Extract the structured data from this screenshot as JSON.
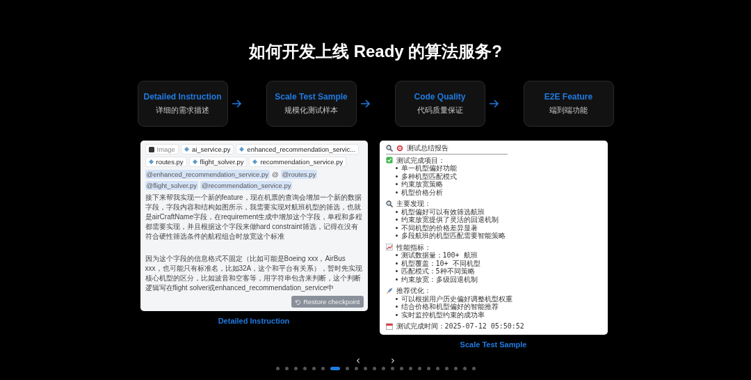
{
  "title": "如何开发上线 Ready 的算法服务?",
  "steps": [
    {
      "title": "Detailed Instruction",
      "subtitle": "详细的需求描述"
    },
    {
      "title": "Scale Test Sample",
      "subtitle": "规模化测试样本"
    },
    {
      "title": "Code Quality",
      "subtitle": "代码质量保证"
    },
    {
      "title": "E2E Feature",
      "subtitle": "端到端功能"
    }
  ],
  "instruction_panel": {
    "attachments": [
      {
        "kind": "image",
        "label": "Image"
      },
      {
        "kind": "file",
        "label": "ai_service.py"
      },
      {
        "kind": "file",
        "label": "enhanced_recommendation_servic..."
      },
      {
        "kind": "file",
        "label": "routes.py"
      },
      {
        "kind": "file",
        "label": "flight_solver.py"
      },
      {
        "kind": "file",
        "label": "recommendation_service.py"
      }
    ],
    "mentions": [
      {
        "kind": "tag",
        "text": "@enhanced_recommendation_service.py"
      },
      {
        "kind": "plain",
        "text": "@"
      },
      {
        "kind": "tag",
        "text": "@routes.py"
      },
      {
        "kind": "tag",
        "text": "@flight_solver.py"
      },
      {
        "kind": "tag",
        "text": "@recommendation_service.py"
      }
    ],
    "paragraphs": [
      "接下来帮我实现一个新的feature，现在机票的查询会增加一个新的数据字段，字段内容和结构如图所示，我需要实现对航班机型的筛选，也就是airCraftName字段，在requirement生成中增加这个字段，单程和多程都需要实现，并且根据这个字段来做hard constraint筛选，记得在没有符合硬性筛选条件的航程组合时放宽这个标准",
      "因为这个字段的信息格式不固定（比如可能是Boeing xxx，AirBus xxx，也可能只有标准名，比如32A，这个和平台有关系），暂时先实现核心机型的区分，比如波音和空客等，用字符串包含来判断，这个判断逻辑写在flight solver或enhanced_recommendation_service中"
    ],
    "button": "Restore checkpoint",
    "caption": "Detailed Instruction"
  },
  "report_panel": {
    "title": "测试总结报告",
    "sections": [
      {
        "kind": "check",
        "heading": "测试完成项目：",
        "items": [
          "单一机型偏好功能",
          "多种机型匹配模式",
          "约束放宽策略",
          "机型价格分析"
        ]
      },
      {
        "kind": "search",
        "heading": "主要发现：",
        "items": [
          "机型偏好可以有效筛选航班",
          "约束放宽提供了灵活的回退机制",
          "不同机型的价格差异显著",
          "多段航班的机型匹配需要智能策略"
        ]
      },
      {
        "kind": "chart",
        "heading": "性能指标：",
        "items": [
          "测试数据量：100+ 航班",
          "机型覆盖：10+ 不同机型",
          "匹配模式：5种不同策略",
          "约束放宽：多级回退机制"
        ]
      },
      {
        "kind": "rocket",
        "heading": "推荐优化：",
        "items": [
          "可以根据用户历史偏好调整机型权重",
          "结合价格和机型偏好的智能推荐",
          "实时监控机型约束的成功率"
        ]
      }
    ],
    "footer": "测试完成时间：2025-07-12 05:50:52",
    "caption": "Scale Test Sample"
  },
  "carousel": {
    "prev": "‹",
    "next": "›",
    "dots": [
      {
        "selected": false
      },
      {
        "selected": false
      },
      {
        "selected": false
      },
      {
        "selected": false
      },
      {
        "selected": false
      },
      {
        "selected": false
      },
      {
        "selected": true
      },
      {
        "selected": false
      },
      {
        "selected": false
      },
      {
        "selected": false
      },
      {
        "selected": false
      },
      {
        "selected": false
      },
      {
        "selected": false
      },
      {
        "selected": false
      },
      {
        "selected": false
      },
      {
        "selected": false
      },
      {
        "selected": false
      },
      {
        "selected": false
      },
      {
        "selected": false
      },
      {
        "selected": false
      },
      {
        "selected": false
      },
      {
        "selected": false
      }
    ]
  }
}
